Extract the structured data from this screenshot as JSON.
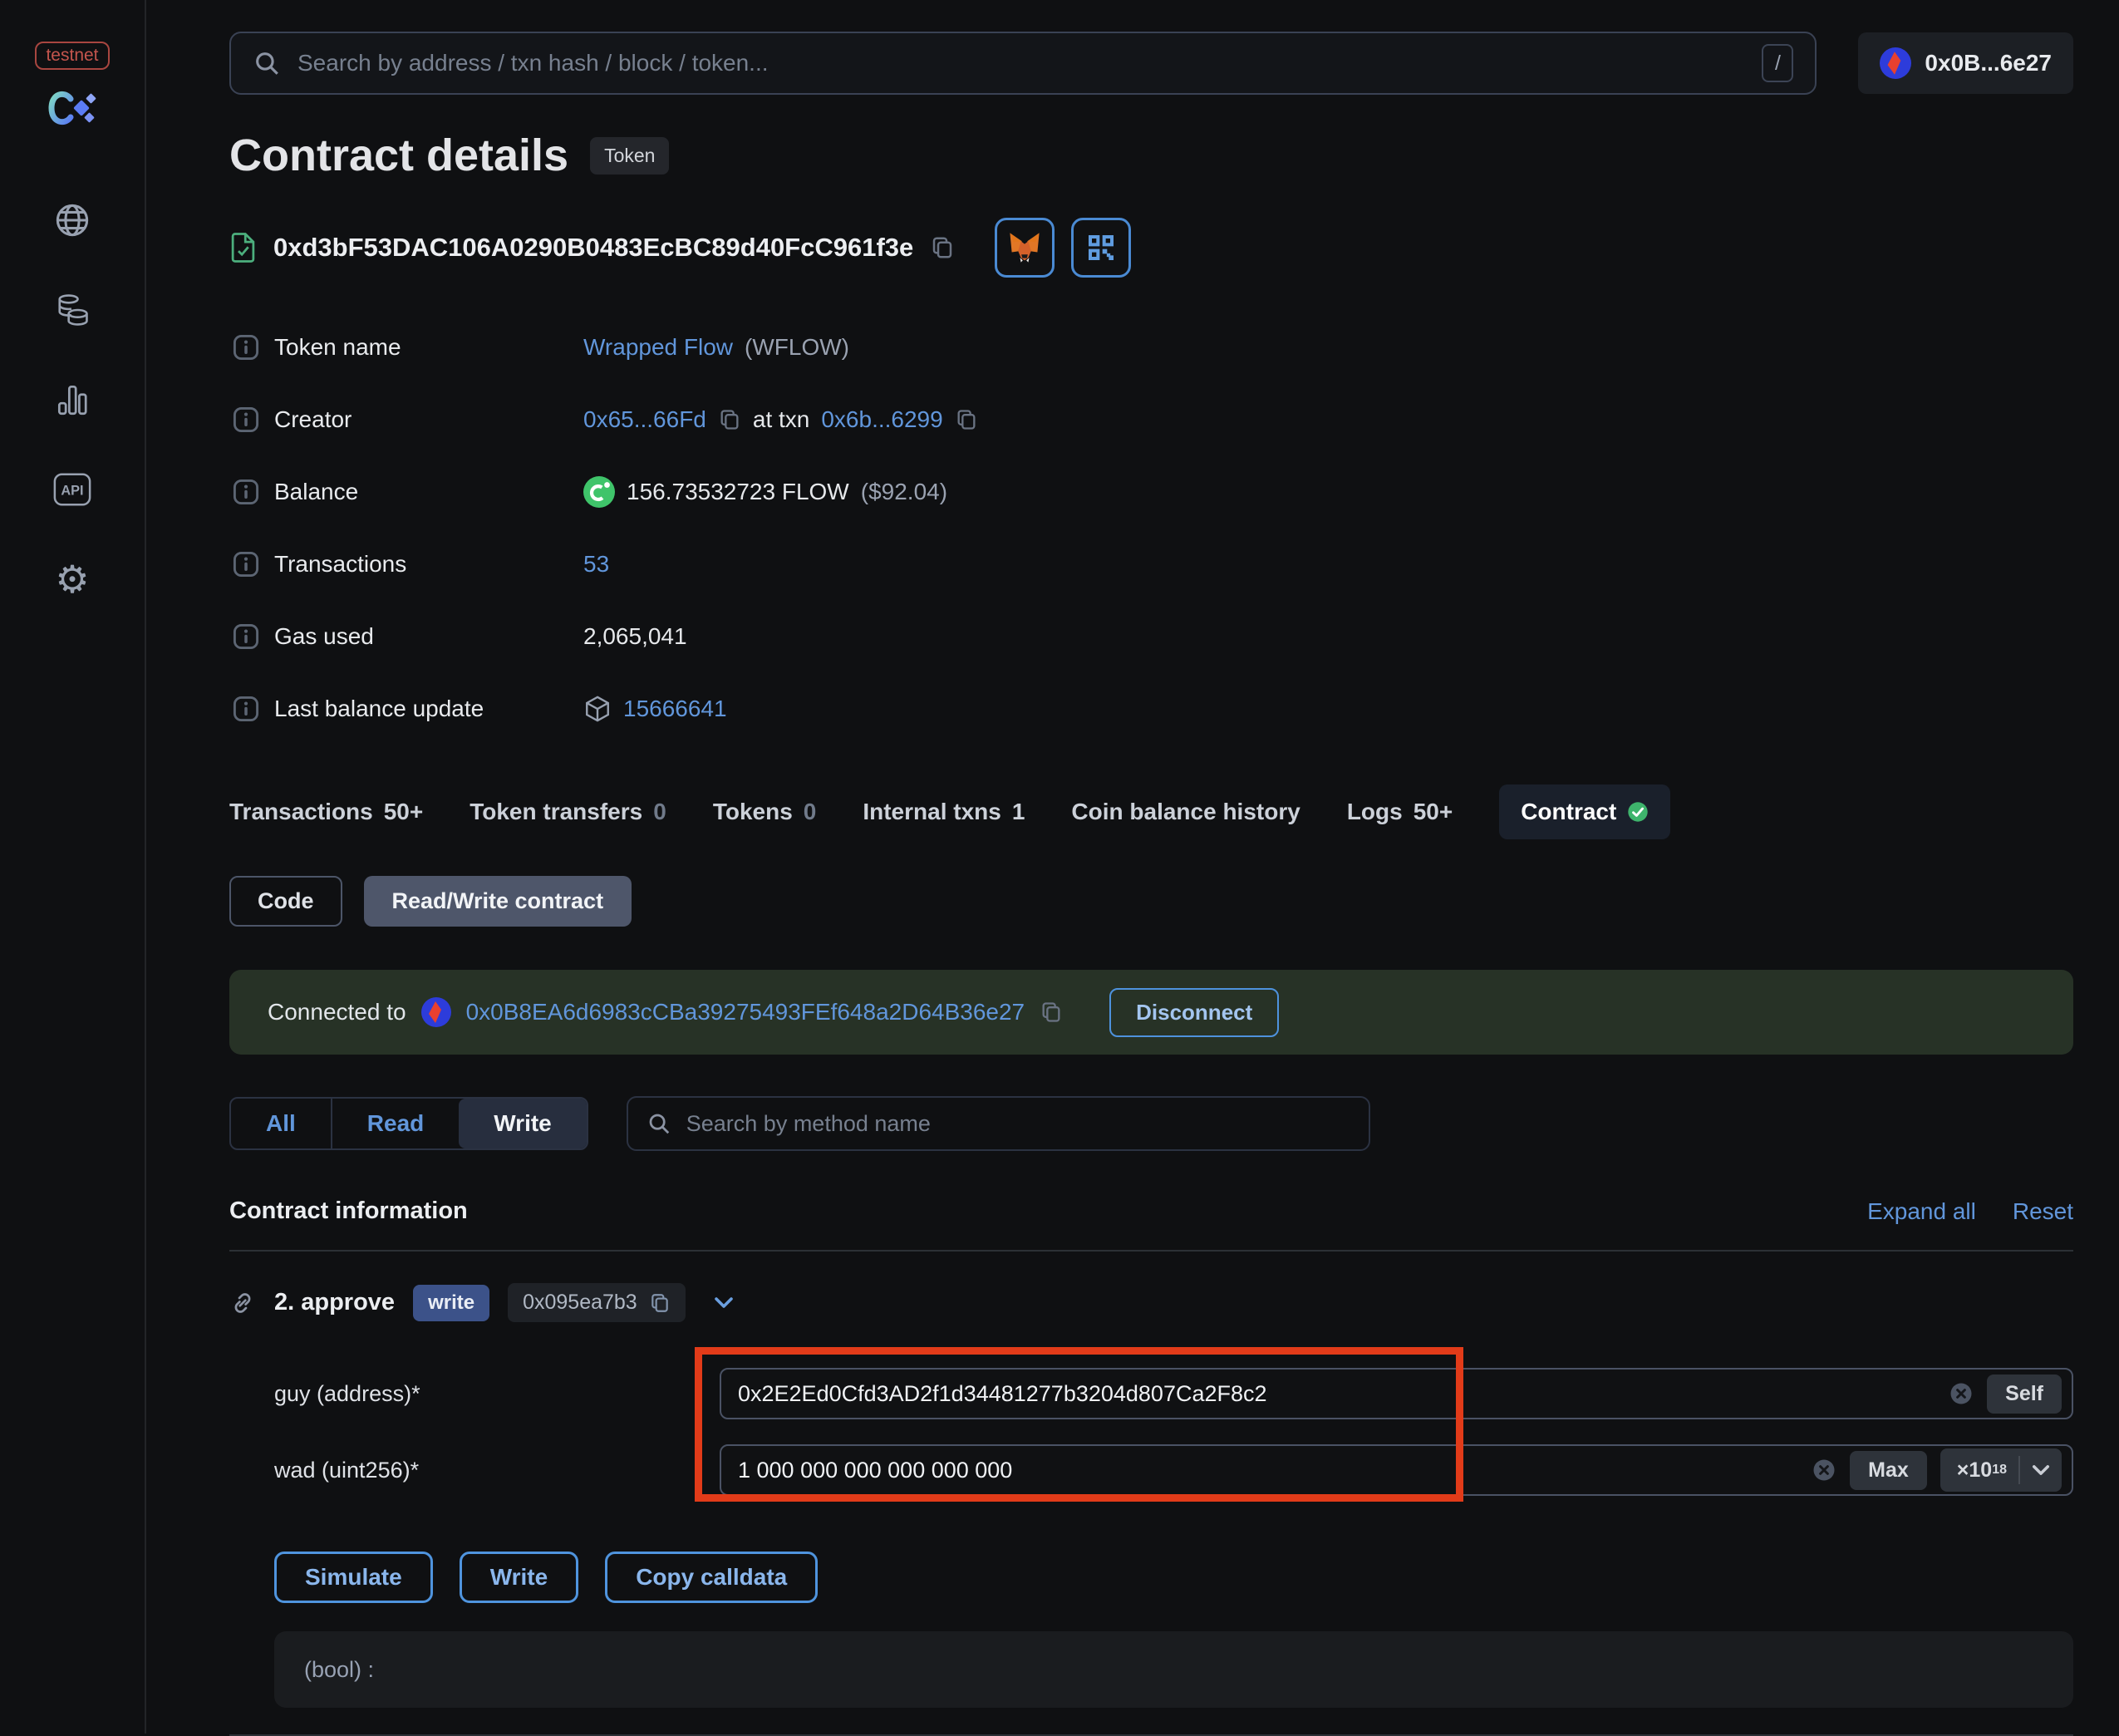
{
  "sidebar": {
    "badge": "testnet"
  },
  "topbar": {
    "search_placeholder": "Search by address / txn hash / block / token...",
    "search_shortcut": "/",
    "account_label": "0x0B...6e27"
  },
  "header": {
    "title": "Contract details",
    "badge": "Token",
    "address": "0xd3bF53DAC106A0290B0483EcBC89d40FcC961f3e"
  },
  "info": {
    "token_name": {
      "label": "Token name",
      "link": "Wrapped Flow",
      "suffix": "(WFLOW)"
    },
    "creator": {
      "label": "Creator",
      "address": "0x65...66Fd",
      "mid": "at txn",
      "txn": "0x6b...6299"
    },
    "balance": {
      "label": "Balance",
      "amount": "156.73532723 FLOW",
      "usd": "($92.04)"
    },
    "transactions": {
      "label": "Transactions",
      "value": "53"
    },
    "gas_used": {
      "label": "Gas used",
      "value": "2,065,041"
    },
    "last_balance_update": {
      "label": "Last balance update",
      "value": "15666641"
    }
  },
  "tabs": [
    {
      "label": "Transactions",
      "count": "50+"
    },
    {
      "label": "Token transfers",
      "count": "0"
    },
    {
      "label": "Tokens",
      "count": "0"
    },
    {
      "label": "Internal txns",
      "count": "1"
    },
    {
      "label": "Coin balance history",
      "count": ""
    },
    {
      "label": "Logs",
      "count": "50+"
    },
    {
      "label": "Contract",
      "count": ""
    }
  ],
  "subtabs": {
    "code": "Code",
    "read_write": "Read/Write contract"
  },
  "connection": {
    "prefix": "Connected to",
    "address": "0x0B8EA6d6983cCBa39275493FEf648a2D64B36e27",
    "disconnect": "Disconnect"
  },
  "filter": {
    "all": "All",
    "read": "Read",
    "write": "Write",
    "search_placeholder": "Search by method name"
  },
  "contract_info": {
    "title": "Contract information",
    "expand_all": "Expand all",
    "reset": "Reset"
  },
  "method": {
    "name": "2. approve",
    "badge": "write",
    "selector": "0x095ea7b3"
  },
  "fields": {
    "guy": {
      "label": "guy (address)*",
      "value": "0x2E2Ed0Cfd3AD2f1d34481277b3204d807Ca2F8c2",
      "action": "Self"
    },
    "wad": {
      "label": "wad (uint256)*",
      "value": "1 000 000 000 000 000 000",
      "action": "Max",
      "multiplier_base": "×10",
      "multiplier_exp": "18"
    }
  },
  "actions": {
    "simulate": "Simulate",
    "write": "Write",
    "copy_calldata": "Copy calldata"
  },
  "output": {
    "placeholder": "(bool) :"
  },
  "colors": {
    "accent_blue": "#6196db",
    "action_blue": "#8ab6ec",
    "highlight_red": "#e23b19",
    "verified_green": "#3eb46c",
    "connected_banner_bg": "#273226",
    "write_badge_bg": "#3c5289"
  }
}
